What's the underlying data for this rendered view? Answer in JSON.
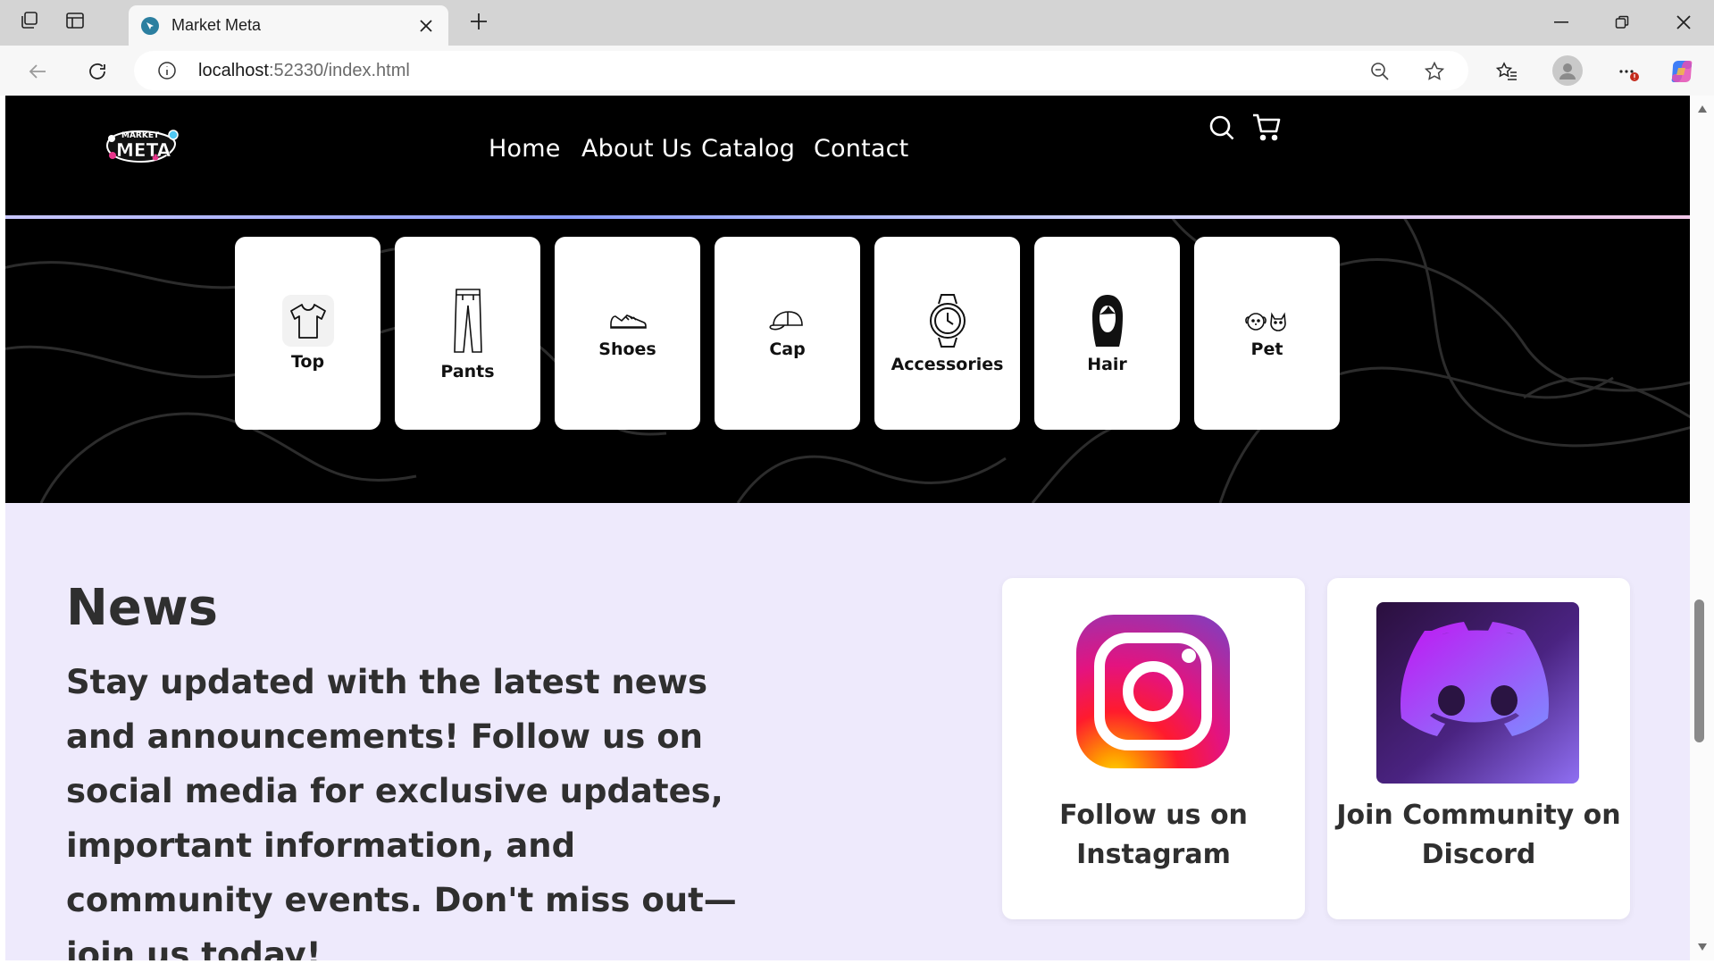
{
  "browser": {
    "tab_title": "Market Meta",
    "url_host": "localhost",
    "url_rest": ":52330/index.html"
  },
  "site": {
    "logo_text": "MARKET META",
    "nav": {
      "home": "Home",
      "about": "About Us",
      "catalog": "Catalog",
      "contact": "Contact"
    },
    "categories": [
      {
        "label": "Top",
        "icon": "tshirt-icon"
      },
      {
        "label": "Pants",
        "icon": "pants-icon"
      },
      {
        "label": "Shoes",
        "icon": "sneaker-icon"
      },
      {
        "label": "Cap",
        "icon": "cap-icon"
      },
      {
        "label": "Accessories",
        "icon": "watch-icon"
      },
      {
        "label": "Hair",
        "icon": "hair-icon"
      },
      {
        "label": "Pet",
        "icon": "pet-icon"
      }
    ],
    "news": {
      "title": "News",
      "body": "Stay updated with the latest news and announcements! Follow us on social media for exclusive updates, important information, and community events. Don't miss out—join us today!",
      "instagram_caption": "Follow us on Instagram",
      "discord_caption": "Join Community on Discord"
    }
  },
  "colors": {
    "nav_bg": "#000000",
    "news_bg": "#eeeafc",
    "text_dark": "#2f2f2f"
  }
}
